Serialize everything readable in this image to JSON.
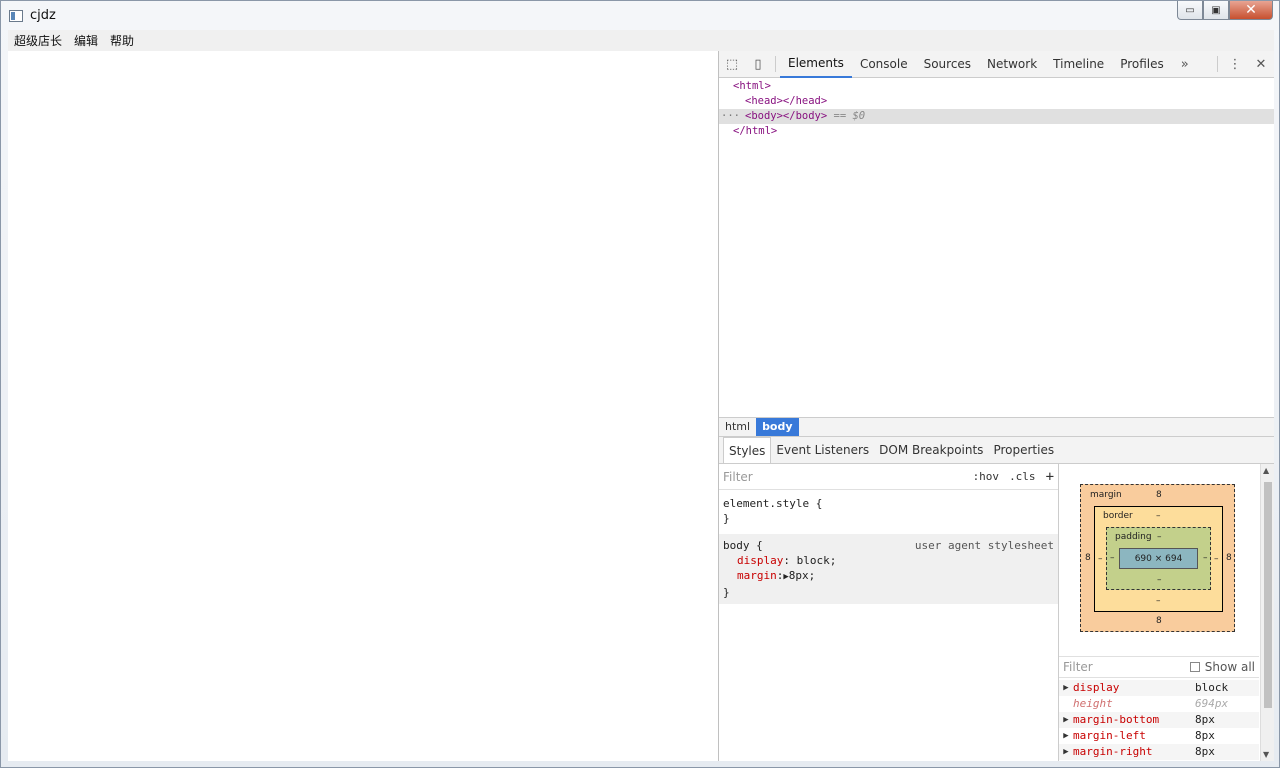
{
  "window": {
    "title": "cjdz",
    "minimize": "▭",
    "maximize": "▣",
    "close": "✕"
  },
  "menu": [
    "超级店长",
    "编辑",
    "帮助"
  ],
  "devtools": {
    "tools": {
      "inspect": "⬚",
      "device": "▯",
      "more": "⋮",
      "close": "✕",
      "overflow": "»"
    },
    "tabs": [
      "Elements",
      "Console",
      "Sources",
      "Network",
      "Timeline",
      "Profiles"
    ],
    "active_tab": "Elements",
    "dom": {
      "line1": "<html>",
      "line2": "<head></head>",
      "line3_dots": "···",
      "line3": "<body></body>",
      "line3_ref": "== $0",
      "line4": "</html>"
    },
    "breadcrumbs": [
      "html",
      "body"
    ],
    "sub_tabs": [
      "Styles",
      "Event Listeners",
      "DOM Breakpoints",
      "Properties"
    ],
    "styles": {
      "filter_placeholder": "Filter",
      "hov": ":hov",
      "cls": ".cls",
      "add": "+",
      "element_style_open": "element.style {",
      "close_brace": "}",
      "body_rule_open": "body {",
      "body_rule_source": "user agent stylesheet",
      "display_name": "display",
      "display_value": "block;",
      "margin_name": "margin",
      "margin_value": "8px;",
      "margin_tri": "▶"
    },
    "box_model": {
      "margin_label": "margin",
      "margin_top": "8",
      "margin_bottom": "8",
      "margin_left": "8",
      "margin_right": "8",
      "border_label": "border",
      "border_top": "–",
      "border_bottom": "–",
      "border_left": "–",
      "border_right": "–",
      "padding_label": "padding",
      "padding_top": "–",
      "padding_bottom": "–",
      "padding_left": "–",
      "padding_right": "–",
      "content": "690 × 694"
    },
    "computed": {
      "filter_placeholder": "Filter",
      "show_all": "Show all",
      "rows": [
        {
          "name": "display",
          "value": "block"
        },
        {
          "name": "height",
          "value": "694px"
        },
        {
          "name": "margin-bottom",
          "value": "8px"
        },
        {
          "name": "margin-left",
          "value": "8px"
        },
        {
          "name": "margin-right",
          "value": "8px"
        }
      ]
    }
  }
}
